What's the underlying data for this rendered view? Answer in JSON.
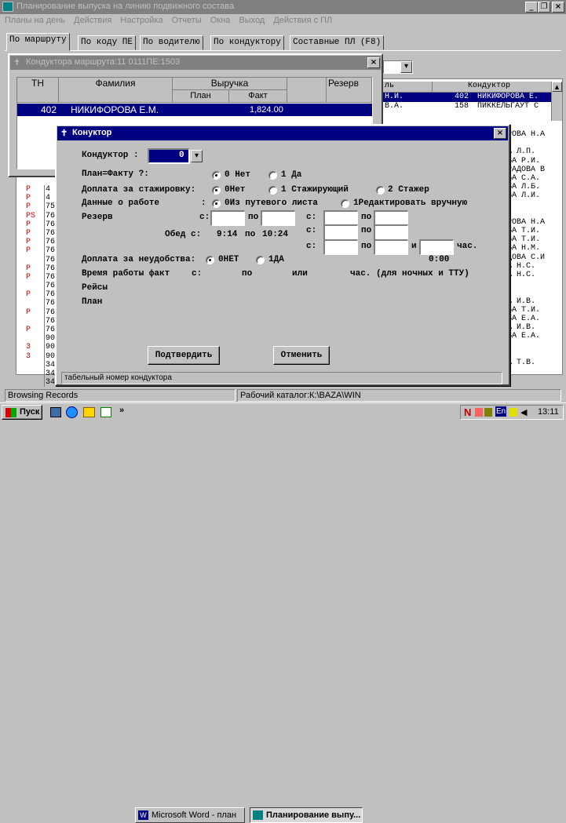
{
  "app": {
    "title": "Планирование выпуска на линию подвижного состава",
    "menu": [
      "Планы на день",
      "Действия",
      "Настройка",
      "Отчеты",
      "Окна",
      "Выход",
      "Действия с ПЛ"
    ]
  },
  "tabs": [
    "По маршруту",
    "По коду ПЕ",
    "По водителю",
    "По кондуктору",
    "Составные ПЛ (F8)"
  ],
  "back_grid": {
    "col_left_header": "ль",
    "col_right_header": "Кондуктор",
    "rows": [
      {
        "left": "Н.И.",
        "num": "402",
        "name": "НИКИФОРОВА Е."
      },
      {
        "left": "В.А.",
        "num": "158",
        "name": "ПИККЕЛЬГАУТ С"
      }
    ],
    "right_names": [
      "РОВА Н.А",
      "",
      "А Л.П.",
      "ВА Р.И.",
      "РАДОВА В",
      "ВА С.А.",
      "ВА Л.Б.",
      "ВА Л.И.",
      "",
      "",
      "РОВА Н.А",
      "ВА Т.И.",
      "ВА Т.И.",
      "ВА Н.М.",
      "ДОВА С.И",
      "А Н.С.",
      "А Н.С.",
      "",
      "",
      "А И.В.",
      "ВА Т.И.",
      "ВА Е.А.",
      "А И.В.",
      "ВА Е.А.",
      "",
      "",
      "А Т.В."
    ],
    "left_codes": [
      "P",
      "P",
      "P",
      "PS",
      "P",
      "P",
      "P",
      "P",
      "",
      "P",
      "P",
      "",
      "P",
      "",
      "P",
      "",
      "P",
      "",
      "3",
      "3",
      ""
    ],
    "left_nums": [
      "4",
      "4",
      "75",
      "76",
      "76",
      "76",
      "76",
      "76",
      "76",
      "76",
      "76",
      "76",
      "76",
      "76",
      "76",
      "76",
      "76",
      "90",
      "90",
      "90",
      "34",
      "34",
      "34"
    ]
  },
  "route_window": {
    "title": "Кондуктора маршрута:11   0111ПЕ:1503",
    "headers": {
      "tn": "ТН",
      "surname": "Фамилия",
      "revenue": "Выручка",
      "plan": "План",
      "fact": "Факт",
      "reserve": "Резерв"
    },
    "row": {
      "tn": "402",
      "surname": "НИКИФОРОВА Е.М.",
      "plan": "",
      "fact": "1,824.00"
    },
    "combo_value": ""
  },
  "dialog": {
    "title": "Конуктор",
    "conductor_label": "Кондуктор :",
    "conductor_value": "0",
    "plan_fact_label": "План=Факту ?:",
    "plan_fact_options": [
      "0 Нет",
      "1 Да"
    ],
    "internship_label": "Доплата за стажировку:",
    "internship_options": [
      "0Нет",
      "1 Стажирующий",
      "2 Стажер"
    ],
    "work_data_label": "Данные о работе",
    "work_data_colon": ":",
    "work_data_options": [
      "0Из путевого листа",
      "1Редактировать вручную"
    ],
    "reserve_label": "Резерв",
    "from_label": "с:",
    "to_label": "по",
    "and_label": "и",
    "hours_label": "час.",
    "lunch_label": "Обед с:",
    "lunch_from": "9:14",
    "lunch_to_label": "по",
    "lunch_to": "10:24",
    "inconvenience_label": "Доплата за неудобства:",
    "inconvenience_options": [
      "0НЕТ",
      "1ДА"
    ],
    "inconvenience_value": "0:00",
    "work_time_label": "Время работы факт",
    "work_time_from": "с:",
    "work_time_to": "по",
    "work_time_or": "или",
    "work_time_hours": "час. (для ночных и ТТУ)",
    "trips_label": "Рейсы",
    "plan_label": "План",
    "confirm_button": "Подтвердить",
    "cancel_button": "Отменить",
    "status_hint": "табельный номер кондуктора"
  },
  "statusbar": {
    "left": "Browsing Records",
    "right": "Рабочий каталог:К:\\BAZA\\WIN"
  },
  "taskbar": {
    "start": "Пуск",
    "tasks": [
      "Microsoft Word - план",
      "Планирование выпу..."
    ],
    "clock": "13:11",
    "lang": "En"
  }
}
